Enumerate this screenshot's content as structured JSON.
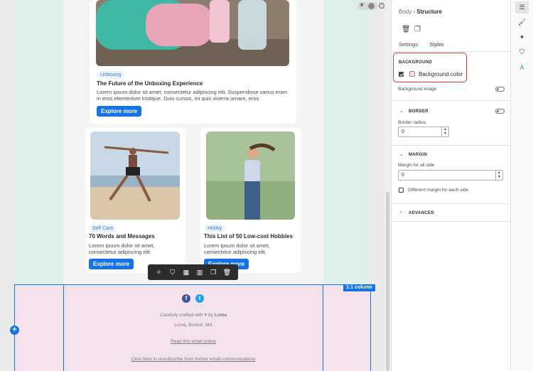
{
  "canvas": {
    "card_main": {
      "tag": "Unboxing",
      "title": "The Future of the Unboxing Experience",
      "body": "Lorem ipsum dolor sit amet, consectetur adipiscing elit. Suspendisse varius enim in eros elementum tristique. Duis cursus, mi quis viverra ornare, eros",
      "button": "Explore more"
    },
    "card_left": {
      "tag": "Self Care",
      "title": "70 Words and Messages",
      "body": "Lorem ipsum dolor sit amet, consectetur adipiscing elit.",
      "button": "Explore more"
    },
    "card_right": {
      "tag": "Hobby",
      "title": "This List of 50 Low-cost Hobbies",
      "body": "Lorem ipsum dolor sit amet, consectetur adipiscing elit.",
      "button": "Explore more"
    },
    "footer": {
      "badge": "1:1 column",
      "crafted_prefix": "Carefully crafted with",
      "crafted_by": "by",
      "brand": "Luma",
      "address": "Luma, Boston, MA",
      "read_online": "Read this email online",
      "unsubscribe": "Click here to unsubscribe from further email communications"
    }
  },
  "panel": {
    "breadcrumb": {
      "parent": "Body",
      "current": "Structure"
    },
    "tabs": [
      "Settings",
      "Styles"
    ],
    "background": {
      "section_label": "BACKGROUND",
      "color_label": "Background color",
      "color_checked": true,
      "color_value": "#f4e3ec",
      "image_label": "Background image"
    },
    "border": {
      "section_label": "BORDER",
      "radius_label": "Border radius",
      "radius_value": "0"
    },
    "margin": {
      "section_label": "MARGIN",
      "all_label": "Margin for all side",
      "all_value": "0",
      "each_label": "Different margin for each side"
    },
    "advanced": {
      "section_label": "ADVANCED"
    }
  },
  "colors": {
    "accent": "#1473e6",
    "highlight": "#d7373f",
    "footer_bg": "#f4e3ec",
    "side_column_bg": "#dcefe9"
  }
}
